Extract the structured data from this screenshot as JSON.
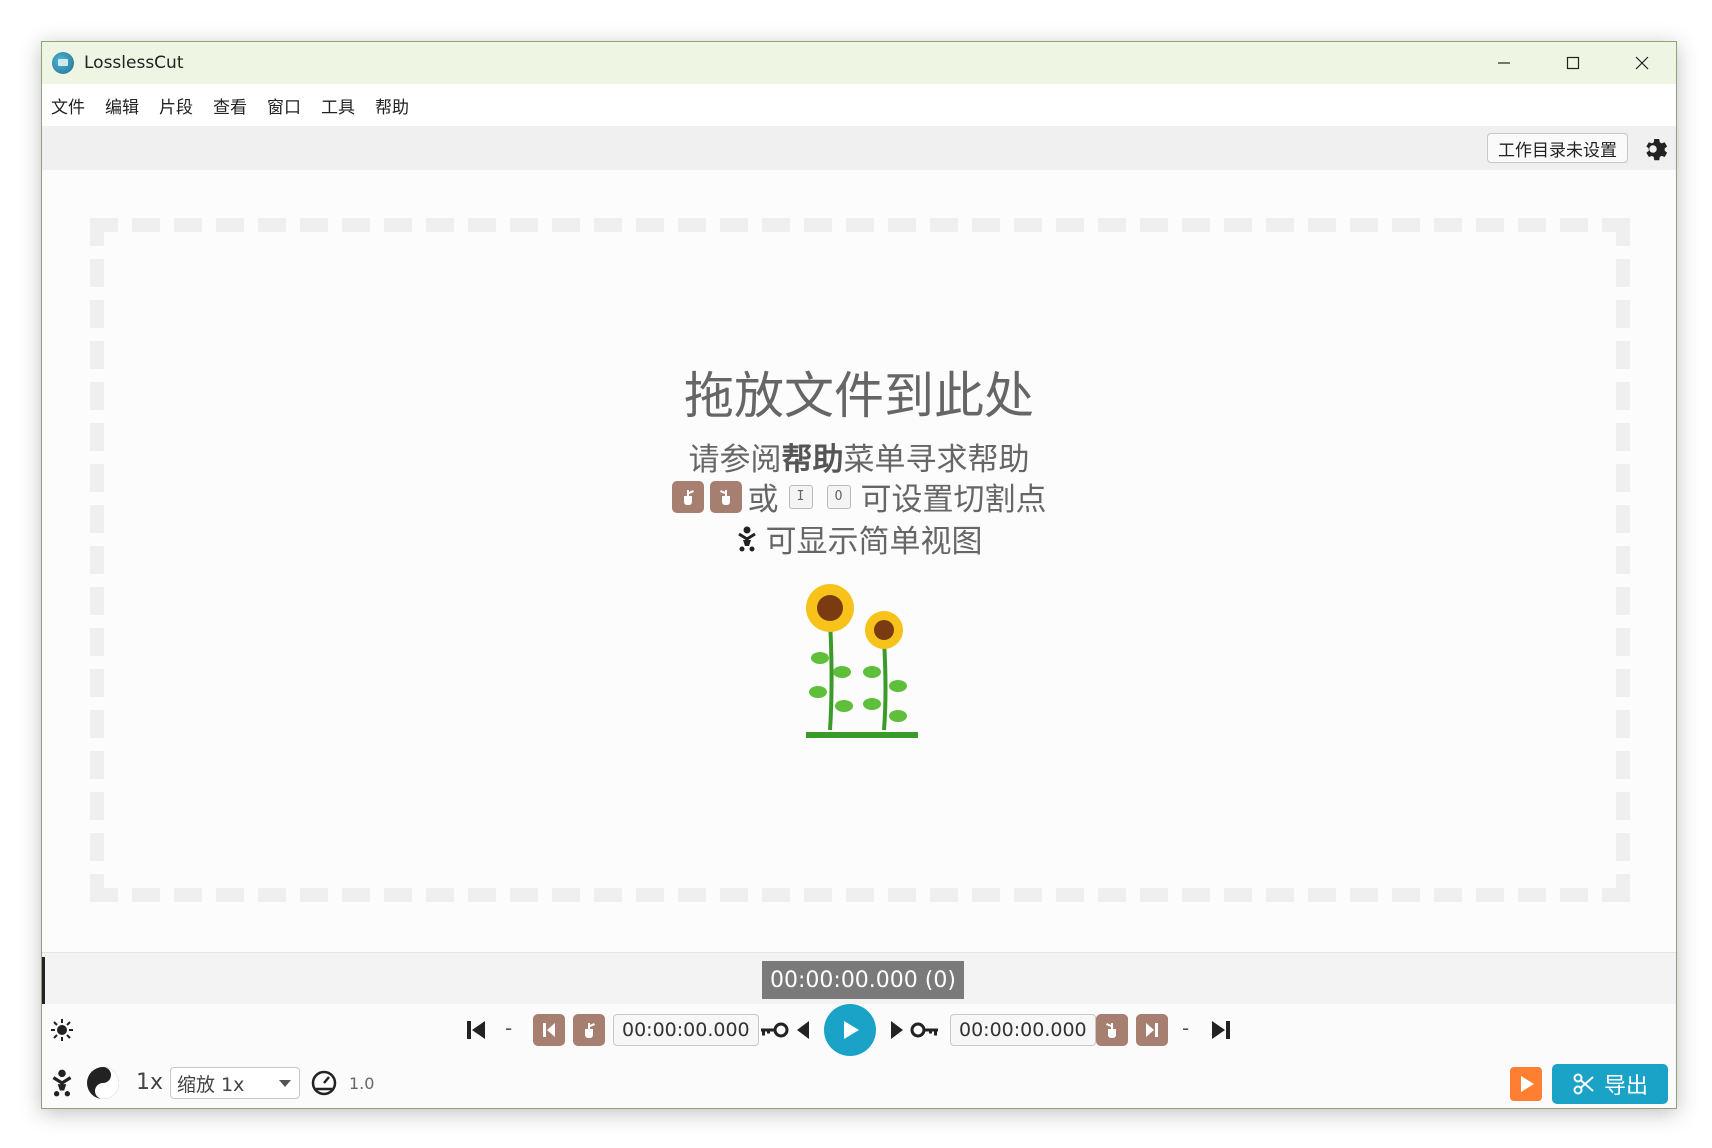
{
  "window": {
    "title": "LosslessCut",
    "controls": {
      "minimize": "—",
      "maximize": "☐",
      "close": "✕"
    }
  },
  "menu": {
    "items": [
      "文件",
      "编辑",
      "片段",
      "查看",
      "窗口",
      "工具",
      "帮助"
    ]
  },
  "toolbar": {
    "workdir_label": "工作目录未设置"
  },
  "drop": {
    "title": "拖放文件到此处",
    "help_prefix": "请参阅",
    "help_bold": "帮助",
    "help_suffix": "菜单寻求帮助",
    "or_text": "或",
    "key_in": "I",
    "key_out": "O",
    "cut_suffix": "可设置切割点",
    "simple_text": "可显示简单视图"
  },
  "timeline": {
    "current_time": "00:00:00.000 (0)"
  },
  "controls": {
    "start_dash": "-",
    "end_dash": "-",
    "cut_start_time": "00:00:00.000",
    "cut_end_time": "00:00:00.000",
    "speed": "1x",
    "zoom_label": "缩放 1x",
    "playback_rate": "1.0",
    "export_label": "导出"
  },
  "colors": {
    "accent": "#1aa3c6",
    "segment_brown": "#a67f70",
    "orange": "#ff7f32",
    "titlebar_bg": "#eef6e3"
  }
}
